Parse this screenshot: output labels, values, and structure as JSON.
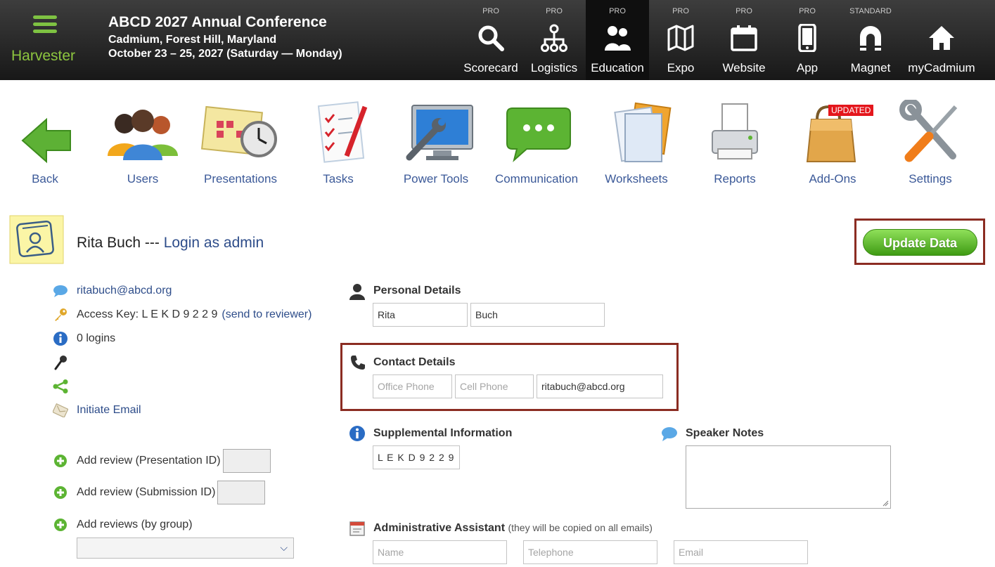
{
  "app": {
    "brand": "Harvester",
    "event_title": "ABCD 2027 Annual Conference",
    "location": "Cadmium, Forest Hill, Maryland",
    "dates": "October 23 – 25, 2027 (Saturday — Monday)"
  },
  "modules": [
    {
      "tier": "PRO",
      "label": "Scorecard",
      "icon": "search-icon"
    },
    {
      "tier": "PRO",
      "label": "Logistics",
      "icon": "org-chart-icon"
    },
    {
      "tier": "PRO",
      "label": "Education",
      "icon": "people-icon",
      "active": true
    },
    {
      "tier": "PRO",
      "label": "Expo",
      "icon": "map-icon"
    },
    {
      "tier": "PRO",
      "label": "Website",
      "icon": "calendar-icon"
    },
    {
      "tier": "PRO",
      "label": "App",
      "icon": "phone-icon"
    },
    {
      "tier": "STANDARD",
      "label": "Magnet",
      "icon": "magnet-icon"
    },
    {
      "tier": "",
      "label": "myCadmium",
      "icon": "home-icon"
    }
  ],
  "toolbar": {
    "back": "Back",
    "users": "Users",
    "presentations": "Presentations",
    "tasks": "Tasks",
    "power_tools": "Power Tools",
    "communication": "Communication",
    "worksheets": "Worksheets",
    "reports": "Reports",
    "addons": "Add-Ons",
    "addons_badge": "UPDATED",
    "settings": "Settings"
  },
  "profile": {
    "name": "Rita Buch",
    "separator": " --- ",
    "login_link": "Login as admin",
    "update_button": "Update Data"
  },
  "left": {
    "email": "ritabuch@abcd.org",
    "access_key_label": "Access Key: L E K D 9 2 2 9",
    "send_link": "(send to reviewer)",
    "logins": "0 logins",
    "initiate_email": "Initiate Email",
    "add_review_presentation": "Add review (Presentation ID)",
    "add_review_submission": "Add review (Submission ID)",
    "add_reviews_group": "Add reviews (by group)"
  },
  "personal": {
    "title": "Personal Details",
    "first_name": "Rita",
    "last_name": "Buch"
  },
  "contact": {
    "title": "Contact Details",
    "office_placeholder": "Office Phone",
    "cell_placeholder": "Cell Phone",
    "email": "ritabuch@abcd.org"
  },
  "supplemental": {
    "title": "Supplemental Information",
    "value": "L E K D 9 2 2 9"
  },
  "speaker_notes": {
    "title": "Speaker Notes"
  },
  "assistant": {
    "title": "Administrative Assistant",
    "subtitle": "(they will be copied on all emails)",
    "name_placeholder": "Name",
    "phone_placeholder": "Telephone",
    "email_placeholder": "Email"
  },
  "colors": {
    "accent_green": "#8dc63f",
    "link_blue": "#2e4d8a",
    "highlight_border": "#8b2c22"
  }
}
